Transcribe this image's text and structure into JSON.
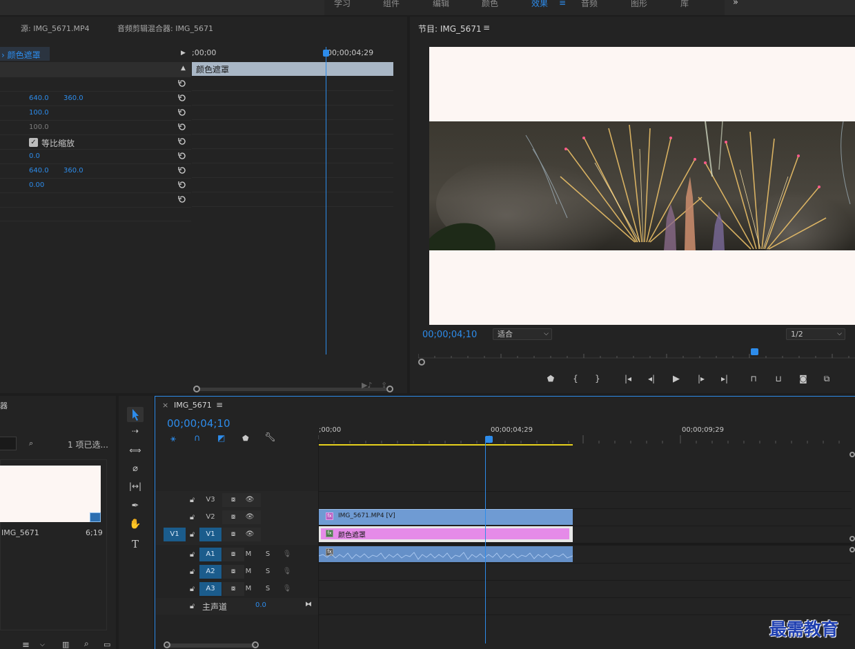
{
  "workspace_tabs": [
    "学习",
    "组件",
    "编辑",
    "颜色",
    "效果",
    "音频",
    "图形",
    "库"
  ],
  "workspace_active": "效果",
  "source_panel": {
    "tab_source": "源: IMG_5671.MP4",
    "tab_mixer": "音频剪辑混合器: IMG_5671",
    "effect_name": "颜色遮罩",
    "timecode_start": ";00;00",
    "timecode_mark": "00;00;04;29",
    "clip_label": "颜色遮罩",
    "rows": [
      {
        "v1": "",
        "v2": ""
      },
      {
        "v1": "640.0",
        "v2": "360.0"
      },
      {
        "v1": "100.0",
        "v2": ""
      },
      {
        "v1": "100.0",
        "v2": ""
      },
      {
        "v1": "",
        "v2": "",
        "checkbox": "等比缩放"
      },
      {
        "v1": "0.0",
        "v2": ""
      },
      {
        "v1": "640.0",
        "v2": "360.0"
      },
      {
        "v1": "0.00",
        "v2": ""
      },
      {
        "v1": "",
        "v2": ""
      }
    ]
  },
  "program_panel": {
    "title": "节目: IMG_5671",
    "timecode": "00;00;04;10",
    "fit_label": "适合",
    "resolution": "1/2"
  },
  "project_panel": {
    "title_fragment": "器",
    "selected_count": "1 项已选...",
    "item_name": "IMG_5671",
    "item_duration": "6;19"
  },
  "timeline": {
    "sequence_name": "IMG_5671",
    "timecode": "00;00;04;10",
    "ruler": [
      ";00;00",
      "00;00;04;29",
      "00;00;09;29"
    ],
    "video_tracks": [
      {
        "name": "V3",
        "source": ""
      },
      {
        "name": "V2",
        "source": ""
      },
      {
        "name": "V1",
        "source": "V1"
      }
    ],
    "audio_tracks": [
      {
        "name": "A1",
        "m": "M",
        "s": "S"
      },
      {
        "name": "A2",
        "m": "M",
        "s": "S"
      },
      {
        "name": "A3",
        "m": "M",
        "s": "S"
      }
    ],
    "master_label": "主声道",
    "master_value": "0.0",
    "clips": {
      "video_clip": "IMG_5671.MP4 [V]",
      "matte_clip": "颜色遮罩"
    }
  },
  "watermark": "最需教育",
  "colors": {
    "accent": "#2d8ceb",
    "panel": "#232323",
    "video_clip": "#6f9bd3",
    "matte_clip": "#e58be8",
    "in_out_bar": "#e8d21c"
  }
}
